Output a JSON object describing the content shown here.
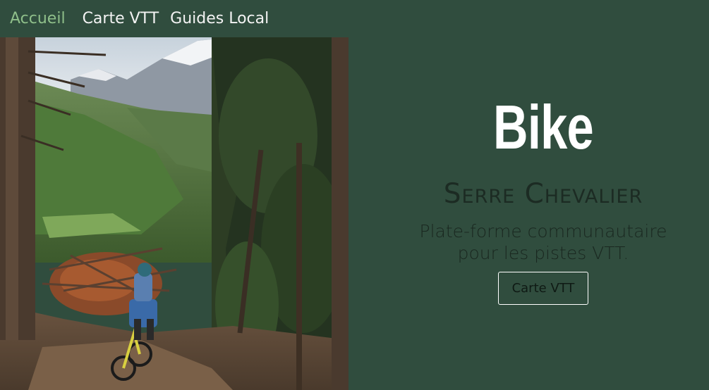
{
  "nav": {
    "items": [
      {
        "label": "Accueil"
      },
      {
        "label": "Carte VTT"
      },
      {
        "label": "Guides Local"
      }
    ]
  },
  "hero": {
    "title": "Bike",
    "subtitle": "Serre Chevalier",
    "tagline_line1": "Plate-forme communautaire",
    "tagline_line2": "pour les pistes VTT.",
    "button_label": "Carte VTT"
  },
  "colors": {
    "background": "#304d3e",
    "nav_active": "#8fbf8a",
    "nav_text": "#f3f3f3",
    "title": "#ffffff",
    "subtitle": "#1c2b23"
  },
  "photo": {
    "icon": "mountain-bike-forest-photo"
  }
}
